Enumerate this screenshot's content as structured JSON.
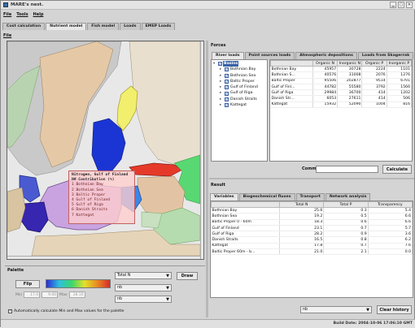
{
  "window": {
    "title": "MARE's nest."
  },
  "menu": [
    "File",
    "Tools",
    "Help"
  ],
  "main_tabs": [
    "Cost calculation",
    "Nutrient model",
    "Fish model",
    "Loads",
    "EMEP Loads"
  ],
  "sub_menu": "File",
  "map_popup": {
    "title": "Nitrogen, Gulf of Finland",
    "subtitle": "N# Contribution (%)",
    "lines": [
      "1 Bothnian Bay",
      "2 Bothnian Sea",
      "3 Baltic Proper",
      "4 Gulf of Finland",
      "5 Gulf of Riga",
      "6 Danish Straits",
      "7 Kattegat"
    ]
  },
  "palette": {
    "label": "Palette",
    "flip_label": "Flip",
    "min_label": "Min",
    "min_value": "17.0",
    "max_label": "Max",
    "max_value": "28.10",
    "mid_value": "9.00",
    "select_variable": "Total N",
    "select_2": "nb",
    "select_3": "nb",
    "draw_label": "Draw",
    "auto_label": "Automatically calculate Min and Max values for the palette",
    "auto_checked": "✓"
  },
  "forces": {
    "label": "Forces",
    "tabs": [
      "River loads",
      "Point sources loads",
      "Atmospheric depositions",
      "Loads from Skagerrak"
    ],
    "tree_root": "Basins",
    "tree_items": [
      "Bothnian Bay",
      "Bothnian Sea",
      "Baltic Proper",
      "Gulf of Finland",
      "Gulf of Riga",
      "Danish Straits",
      "Kattegat"
    ],
    "columns": [
      "",
      "Organic N",
      "Inorganic N",
      "Organic P",
      "Inorganic P"
    ],
    "rows": [
      [
        "Bothnian Bay",
        "45957",
        "30728",
        "2224",
        "1101"
      ],
      [
        "Bothnian S...",
        "40576",
        "31008",
        "2076",
        "1276"
      ],
      [
        "Baltic Proper",
        "95506",
        "202877",
        "9514",
        "6701"
      ],
      [
        "Gulf of Finl...",
        "44782",
        "55580",
        "3792",
        "1566"
      ],
      [
        "Gulf of Riga",
        "29984",
        "36700",
        "414",
        "1202"
      ],
      [
        "Danish Str...",
        "6053",
        "27611",
        "414",
        "506"
      ],
      [
        "Kattegat",
        "15932",
        "52090",
        "1004",
        "816"
      ]
    ],
    "comment_label": "Comment:",
    "comment_value": "",
    "calculate_label": "Calculate"
  },
  "result": {
    "label": "Result",
    "tabs": [
      "Variables",
      "Biogeochemical fluxes",
      "Transport",
      "Network analysis"
    ],
    "columns": [
      "",
      "Total N",
      "Total P",
      "Transparency"
    ],
    "rows": [
      [
        "Bothnian Bay",
        "25.6",
        "0.3",
        "5.4"
      ],
      [
        "Bothnian Sea",
        "19.2",
        "0.5",
        "6.6"
      ],
      [
        "Baltic Proper 0 - 60m",
        "18.3",
        "0.6",
        "6.6"
      ],
      [
        "Gulf of Finland",
        "23.1",
        "0.7",
        "5.7"
      ],
      [
        "Gulf of Riga",
        "28.2",
        "0.9",
        "3.6"
      ],
      [
        "Danish Straits",
        "16.5",
        "0.8",
        "6.2"
      ],
      [
        "Kattegat",
        "17.8",
        "0.7",
        "7.6"
      ],
      [
        "Baltic Proper 60m - b...",
        "21.0",
        "2.1",
        "0.0"
      ]
    ],
    "select_value": "nb",
    "clear_label": "Clear history"
  },
  "status": {
    "build": "Build Date: 2004-10-06 17:06:10 GMT"
  }
}
